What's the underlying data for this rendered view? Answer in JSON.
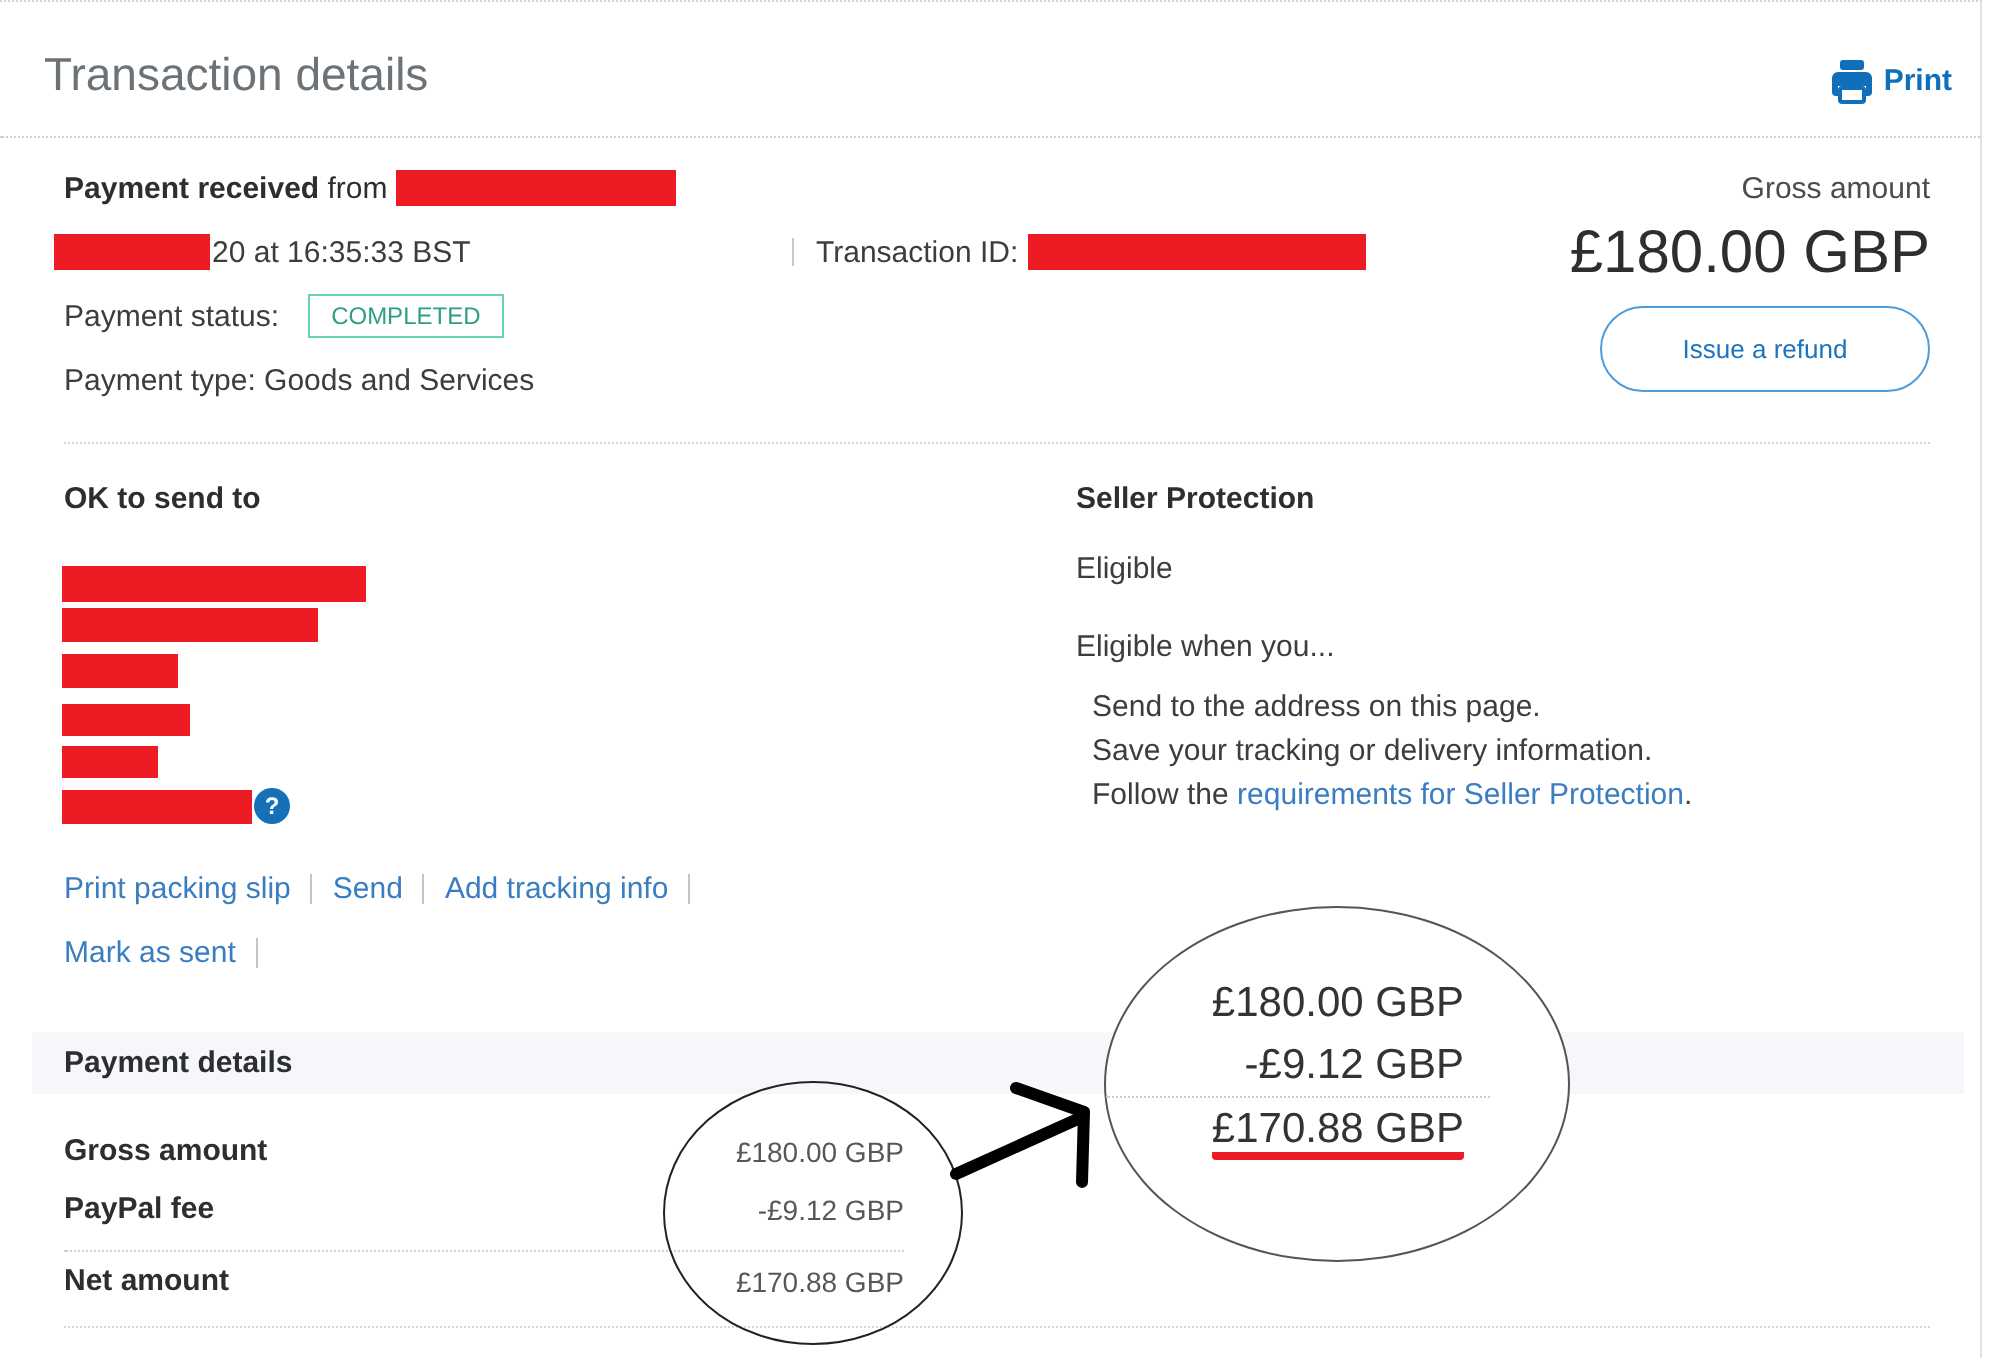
{
  "header": {
    "title": "Transaction details",
    "print_label": "Print"
  },
  "summary": {
    "received": "**Payment received** from",
    "datetime": "20 at 16:35:33 BST",
    "transaction_label": "Transaction ID:",
    "status_label": "Payment status:",
    "status": "COMPLETED",
    "payment_type": "Payment type: Goods and Services",
    "gross_label": "Gross amount",
    "gross_value": "£180.00 GBP",
    "refund_button": "Issue a refund"
  },
  "shipping": {
    "heading": "OK to send to",
    "help_icon": "?",
    "actions": [
      "Print packing slip",
      "Send",
      "Add tracking info",
      "Mark as sent"
    ]
  },
  "seller_protection": {
    "heading": "Seller Protection",
    "status": "Eligible",
    "intro": "Eligible when you...",
    "conditions": [
      {
        "kind": "plain",
        "text": "Send to the address on this page."
      },
      {
        "kind": "plain",
        "text": "Save your tracking or delivery information."
      },
      {
        "kind": "link",
        "text": "Follow the ",
        "link": "requirements for Seller Protection",
        "after": "."
      }
    ]
  },
  "payment_details": {
    "heading": "Payment details",
    "rows": [
      {
        "kind": "line",
        "label": "Gross amount",
        "value": "£180.00 GBP"
      },
      {
        "kind": "line",
        "label": "PayPal fee",
        "value": "-£9.12 GBP"
      },
      {
        "kind": "total",
        "label": "Net amount",
        "value": "£170.88 GBP"
      }
    ]
  },
  "annotations": {
    "callout_lines": [
      {
        "text": "£180.00 GBP",
        "underlined": false
      },
      {
        "text": "-£9.12 GBP",
        "underlined": false
      },
      {
        "text": "£170.88 GBP",
        "underlined": true
      }
    ]
  }
}
